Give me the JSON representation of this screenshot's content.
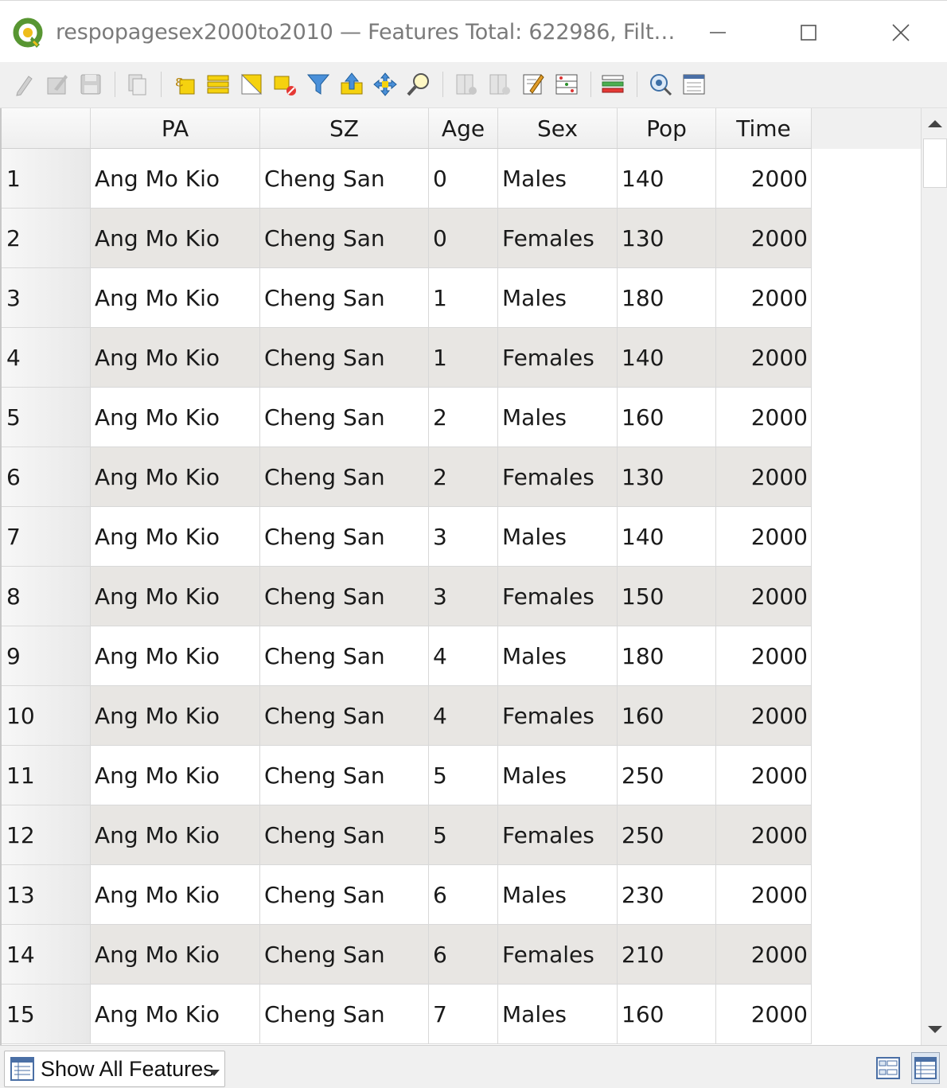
{
  "window": {
    "title": "respopagesex2000to2010 — Features Total: 622986, Filt…"
  },
  "toolbar": {
    "icons": [
      "toggle-editing-icon",
      "toggle-multi-edit-icon",
      "save-edits-icon",
      "copy-selected-icon",
      "select-by-expression-icon",
      "select-all-icon",
      "invert-selection-icon",
      "deselect-all-icon",
      "filter-select-icon",
      "move-selection-to-top-icon",
      "pan-to-selection-icon",
      "zoom-to-selection-icon",
      "new-field-icon",
      "delete-field-icon",
      "open-field-calculator-icon",
      "conditional-formatting-icon",
      "organize-columns-icon",
      "actions-icon",
      "dock-table-icon"
    ]
  },
  "table": {
    "columns": [
      "PA",
      "SZ",
      "Age",
      "Sex",
      "Pop",
      "Time"
    ],
    "rows": [
      {
        "id": "1",
        "PA": "Ang Mo Kio",
        "SZ": "Cheng San",
        "Age": "0",
        "Sex": "Males",
        "Pop": "140",
        "Time": "2000"
      },
      {
        "id": "2",
        "PA": "Ang Mo Kio",
        "SZ": "Cheng San",
        "Age": "0",
        "Sex": "Females",
        "Pop": "130",
        "Time": "2000"
      },
      {
        "id": "3",
        "PA": "Ang Mo Kio",
        "SZ": "Cheng San",
        "Age": "1",
        "Sex": "Males",
        "Pop": "180",
        "Time": "2000"
      },
      {
        "id": "4",
        "PA": "Ang Mo Kio",
        "SZ": "Cheng San",
        "Age": "1",
        "Sex": "Females",
        "Pop": "140",
        "Time": "2000"
      },
      {
        "id": "5",
        "PA": "Ang Mo Kio",
        "SZ": "Cheng San",
        "Age": "2",
        "Sex": "Males",
        "Pop": "160",
        "Time": "2000"
      },
      {
        "id": "6",
        "PA": "Ang Mo Kio",
        "SZ": "Cheng San",
        "Age": "2",
        "Sex": "Females",
        "Pop": "130",
        "Time": "2000"
      },
      {
        "id": "7",
        "PA": "Ang Mo Kio",
        "SZ": "Cheng San",
        "Age": "3",
        "Sex": "Males",
        "Pop": "140",
        "Time": "2000"
      },
      {
        "id": "8",
        "PA": "Ang Mo Kio",
        "SZ": "Cheng San",
        "Age": "3",
        "Sex": "Females",
        "Pop": "150",
        "Time": "2000"
      },
      {
        "id": "9",
        "PA": "Ang Mo Kio",
        "SZ": "Cheng San",
        "Age": "4",
        "Sex": "Males",
        "Pop": "180",
        "Time": "2000"
      },
      {
        "id": "10",
        "PA": "Ang Mo Kio",
        "SZ": "Cheng San",
        "Age": "4",
        "Sex": "Females",
        "Pop": "160",
        "Time": "2000"
      },
      {
        "id": "11",
        "PA": "Ang Mo Kio",
        "SZ": "Cheng San",
        "Age": "5",
        "Sex": "Males",
        "Pop": "250",
        "Time": "2000"
      },
      {
        "id": "12",
        "PA": "Ang Mo Kio",
        "SZ": "Cheng San",
        "Age": "5",
        "Sex": "Females",
        "Pop": "250",
        "Time": "2000"
      },
      {
        "id": "13",
        "PA": "Ang Mo Kio",
        "SZ": "Cheng San",
        "Age": "6",
        "Sex": "Males",
        "Pop": "230",
        "Time": "2000"
      },
      {
        "id": "14",
        "PA": "Ang Mo Kio",
        "SZ": "Cheng San",
        "Age": "6",
        "Sex": "Females",
        "Pop": "210",
        "Time": "2000"
      },
      {
        "id": "15",
        "PA": "Ang Mo Kio",
        "SZ": "Cheng San",
        "Age": "7",
        "Sex": "Males",
        "Pop": "160",
        "Time": "2000"
      }
    ]
  },
  "statusbar": {
    "filter_label": "Show All Features",
    "view_buttons": [
      "form-view-icon",
      "table-view-icon"
    ]
  },
  "colors": {
    "alt_row": "#e8e6e3",
    "qgis_green": "#589632",
    "qgis_yellow": "#eebd1a"
  }
}
